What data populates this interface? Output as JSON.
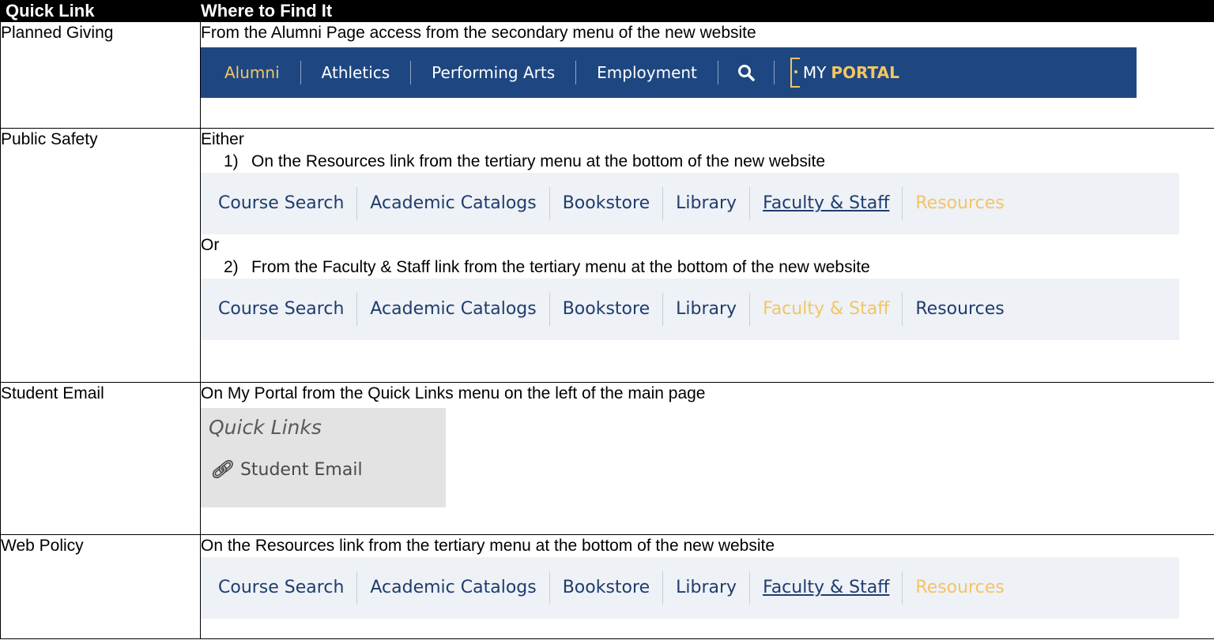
{
  "header": {
    "col1": "Quick Link",
    "col2": "Where to Find It"
  },
  "rows": {
    "planned": {
      "label": "Planned Giving",
      "text": "From the Alumni Page access from the secondary menu of the new website",
      "menu": [
        "Alumni",
        "Athletics",
        "Performing Arts",
        "Employment"
      ],
      "portal_prefix": "MY",
      "portal_strong": "PORTAL"
    },
    "safety": {
      "label": "Public Safety",
      "either": "Either",
      "opt1_num": "1)",
      "opt1_text": "On the Resources link from the tertiary menu at the bottom of the new website",
      "or": "Or",
      "opt2_num": "2)",
      "opt2_text": "From the Faculty & Staff link from the tertiary menu at the bottom of the new website"
    },
    "email": {
      "label": "Student Email",
      "text": "On My Portal from the Quick Links menu on the left of the main page",
      "panel_title": "Quick Links",
      "panel_item": "Student Email"
    },
    "policy": {
      "label": "Web Policy",
      "text": "On the Resources link from the tertiary menu at the bottom of the new website"
    }
  },
  "tertiary": [
    "Course Search",
    "Academic Catalogs",
    "Bookstore",
    "Library",
    "Faculty & Staff",
    "Resources"
  ],
  "colors": {
    "navy": "#1e4782",
    "gold": "#f2c564",
    "link": "#1e3d6e",
    "bar": "#eef1f6"
  }
}
